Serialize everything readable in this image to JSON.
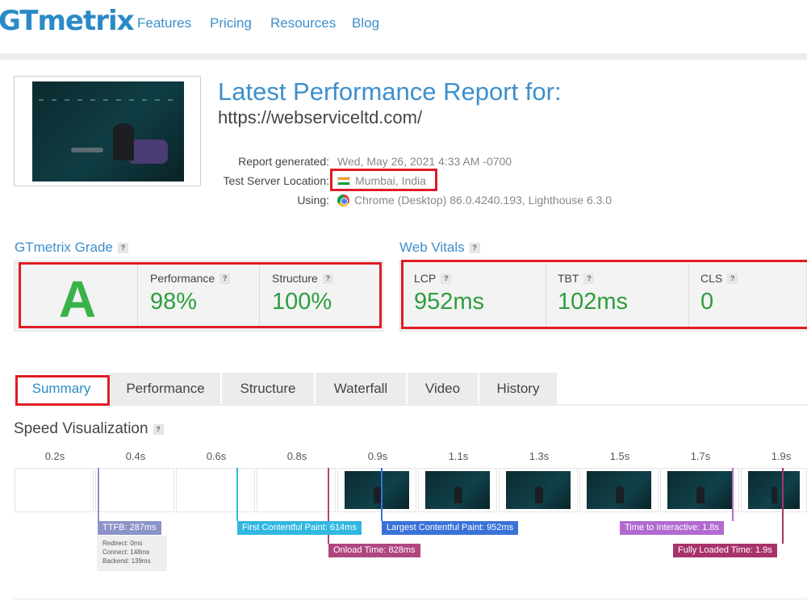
{
  "nav": {
    "logo": "GTmetrix",
    "links": [
      "Features",
      "Pricing",
      "Resources",
      "Blog"
    ]
  },
  "report": {
    "title": "Latest Performance Report for:",
    "url": "https://webserviceltd.com/",
    "generated_label": "Report generated:",
    "generated_value": "Wed, May 26, 2021 4:33 AM -0700",
    "location_label": "Test Server Location:",
    "location_value": "Mumbai, India",
    "using_label": "Using:",
    "using_value": "Chrome (Desktop) 86.0.4240.193, Lighthouse 6.3.0"
  },
  "grade": {
    "title": "GTmetrix Grade",
    "letter": "A",
    "performance_label": "Performance",
    "performance_value": "98%",
    "structure_label": "Structure",
    "structure_value": "100%"
  },
  "vitals": {
    "title": "Web Vitals",
    "lcp_label": "LCP",
    "lcp_value": "952ms",
    "tbt_label": "TBT",
    "tbt_value": "102ms",
    "cls_label": "CLS",
    "cls_value": "0"
  },
  "tabs": [
    "Summary",
    "Performance",
    "Structure",
    "Waterfall",
    "Video",
    "History"
  ],
  "active_tab": "Summary",
  "speed": {
    "title": "Speed Visualization",
    "frame_times": [
      "0.2s",
      "0.4s",
      "0.6s",
      "0.8s",
      "0.9s",
      "1.1s",
      "1.3s",
      "1.5s",
      "1.7s",
      "1.9s"
    ],
    "markers": {
      "ttfb": "TTFB: 287ms",
      "fcp": "First Contentful Paint: 614ms",
      "lcp": "Largest Contentful Paint: 952ms",
      "onload": "Onload Time: 828ms",
      "tti": "Time to Interactive: 1.8s",
      "fully_loaded": "Fully Loaded Time: 1.9s"
    },
    "ttfb_details": {
      "redirect": "Redirect: 0ms",
      "connect": "Connect: 148ms",
      "backend": "Backend: 139ms"
    }
  },
  "colors": {
    "brand_blue": "#3d8fcc",
    "grade_green": "#38b249",
    "value_green": "#2e9e3e",
    "highlight_red": "#e01b24",
    "ttfb": "#8c93c8",
    "fcp": "#30b8e0",
    "lcp": "#3a72d8",
    "onload": "#b0467f",
    "tti": "#b06ad0",
    "fully_loaded": "#a8336b"
  }
}
